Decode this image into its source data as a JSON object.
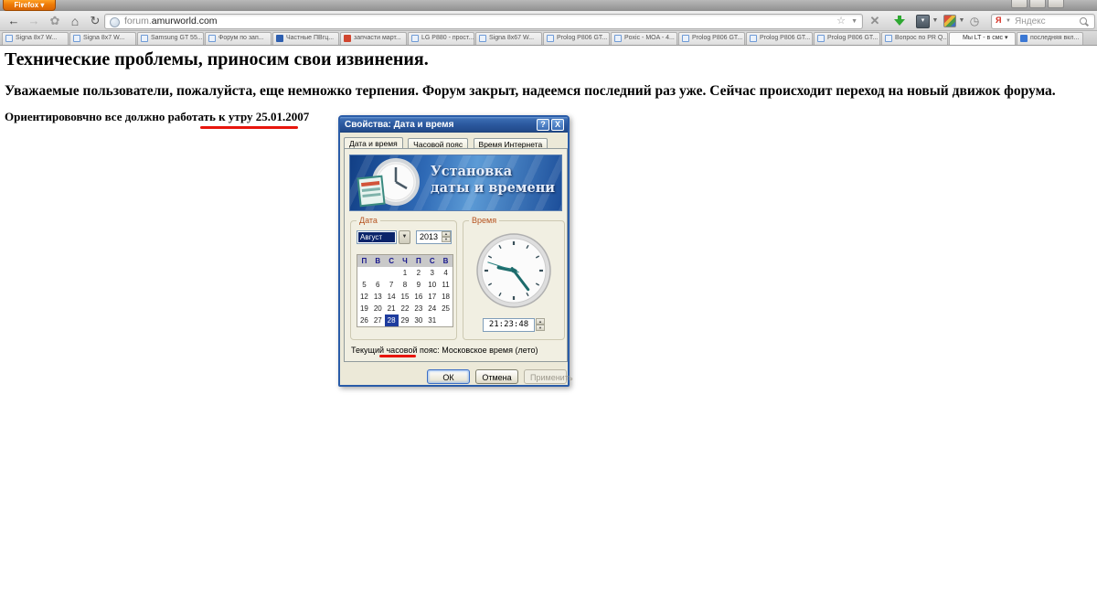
{
  "colors": {
    "firefox_button_orange": "#ee7b07",
    "xp_titlebar_blue": "#2c5aa0",
    "banner_blue": "#2e69b5",
    "selection_navy": "#0a246a",
    "annotation_red": "#e8150d",
    "group_label_rust": "#b5521f",
    "download_green": "#2fa832"
  },
  "browser": {
    "firefox_button": "Firefox",
    "url": {
      "prefix": "forum.",
      "domain": "amurworld.com"
    },
    "search_engine": "Яндекс",
    "tabs": [
      {
        "label": "Signa 8x7 W...",
        "icon": "page"
      },
      {
        "label": "Signa 8x7 W...",
        "icon": "page"
      },
      {
        "label": "Samsung GT 55...",
        "icon": "page"
      },
      {
        "label": "Форум по зап...",
        "icon": "page"
      },
      {
        "label": "Частные ПВгц...",
        "icon": "w"
      },
      {
        "label": "запчасти март...",
        "icon": "red"
      },
      {
        "label": "LG P880 - прост...",
        "icon": "page"
      },
      {
        "label": "Signa 8x67 W...",
        "icon": "page"
      },
      {
        "label": "Prolog P806 GT...",
        "icon": "page"
      },
      {
        "label": "Poxic - MOA - 4...",
        "icon": "page"
      },
      {
        "label": "Prolog P806 GT...",
        "icon": "page"
      },
      {
        "label": "Prolog P806 GT...",
        "icon": "page"
      },
      {
        "label": "Prolog P806 GT...",
        "icon": "page"
      },
      {
        "label": "Вопрос по PR Q...",
        "icon": "page"
      },
      {
        "label": "Мы LT - в смс ▾",
        "icon": "none",
        "selected": true
      },
      {
        "label": "последняя вкл...",
        "icon": "blue"
      }
    ]
  },
  "page": {
    "heading": "Технические проблемы, приносим свои извинения.",
    "paragraph": "Уважаемые пользователи, пожалуйста, еще немножко терпения. Форум закрыт, надеемся последний раз уже. Сейчас происходит переход на новый движок форума.",
    "note": "Ориентирововчно все должно работать к утру 25.01.2007"
  },
  "dialog": {
    "title": "Свойства: Дата и время",
    "titlebar_buttons": {
      "help": "?",
      "close": "X"
    },
    "tabs": [
      {
        "label": "Дата и время",
        "active": true
      },
      {
        "label": "Часовой пояс",
        "active": false
      },
      {
        "label": "Время Интернета",
        "active": false
      }
    ],
    "banner": {
      "line1": "Установка",
      "line2": "даты и времени"
    },
    "date_group": {
      "label": "Дата",
      "month": "Август",
      "year": "2013",
      "weekdays": [
        "П",
        "В",
        "С",
        "Ч",
        "П",
        "С",
        "В"
      ],
      "weeks": [
        [
          "",
          "",
          "",
          "1",
          "2",
          "3",
          "4"
        ],
        [
          "5",
          "6",
          "7",
          "8",
          "9",
          "10",
          "11"
        ],
        [
          "12",
          "13",
          "14",
          "15",
          "16",
          "17",
          "18"
        ],
        [
          "19",
          "20",
          "21",
          "22",
          "23",
          "24",
          "25"
        ],
        [
          "26",
          "27",
          "28",
          "29",
          "30",
          "31",
          ""
        ]
      ],
      "selected_day": "28"
    },
    "time_group": {
      "label": "Время",
      "time": "21:23:48"
    },
    "timezone_note": "Текущий часовой пояс: Московское время (лето)",
    "buttons": [
      {
        "label": "ОК",
        "state": "default"
      },
      {
        "label": "Отмена",
        "state": "normal"
      },
      {
        "label": "Применить",
        "state": "disabled"
      }
    ]
  }
}
